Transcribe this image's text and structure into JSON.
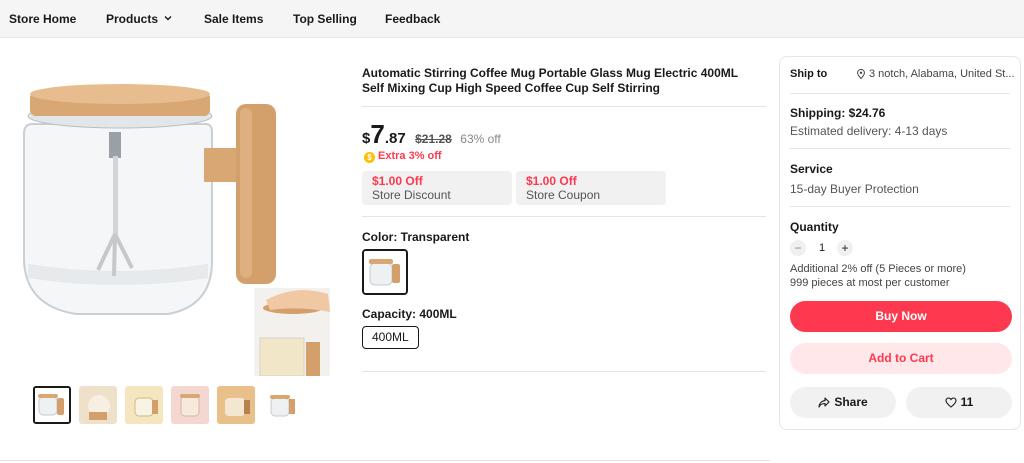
{
  "nav": {
    "items": [
      "Store Home",
      "Products",
      "Sale Items",
      "Top Selling",
      "Feedback"
    ]
  },
  "product": {
    "title": "Automatic Stirring Coffee Mug Portable Glass Mug Electric 400ML Self Mixing Cup High Speed Coffee Cup Self Stirring",
    "price_currency": "$",
    "price_int": "7",
    "price_dec": ".87",
    "price_original": "$21.28",
    "discount": "63% off",
    "extra_discount": "Extra 3% off",
    "coupons": [
      {
        "amount": "$1.00 Off",
        "label": "Store Discount"
      },
      {
        "amount": "$1.00 Off",
        "label": "Store Coupon"
      }
    ],
    "color_label": "Color: Transparent",
    "capacity_label": "Capacity: 400ML",
    "capacity_option": "400ML"
  },
  "gallery": {
    "thumb_count": 6,
    "active_index": 0
  },
  "panel": {
    "ship_to_label": "Ship to",
    "ship_to_value": "3 notch, Alabama, United St...",
    "shipping": "Shipping: $24.76",
    "delivery": "Estimated delivery: 4-13 days",
    "service_title": "Service",
    "service_value": "15-day Buyer Protection",
    "quantity_title": "Quantity",
    "quantity_value": "1",
    "qty_minus": "−",
    "qty_plus": "+",
    "bulk_note": "Additional 2% off (5 Pieces or more)",
    "limit_note": "999 pieces at most per customer",
    "buy_now": "Buy Now",
    "add_to_cart": "Add to Cart",
    "share": "Share",
    "wishlist_count": "11"
  },
  "colors": {
    "accent": "#fd384f",
    "accent_light": "#ffe7ea",
    "coin": "#ffc000",
    "wood": "#d3a06c"
  },
  "icons": {
    "products_dropdown": "chevron-down-icon",
    "location": "location-pin-icon",
    "extra_discount": "coin-icon",
    "share": "share-icon",
    "wishlist": "heart-icon"
  }
}
